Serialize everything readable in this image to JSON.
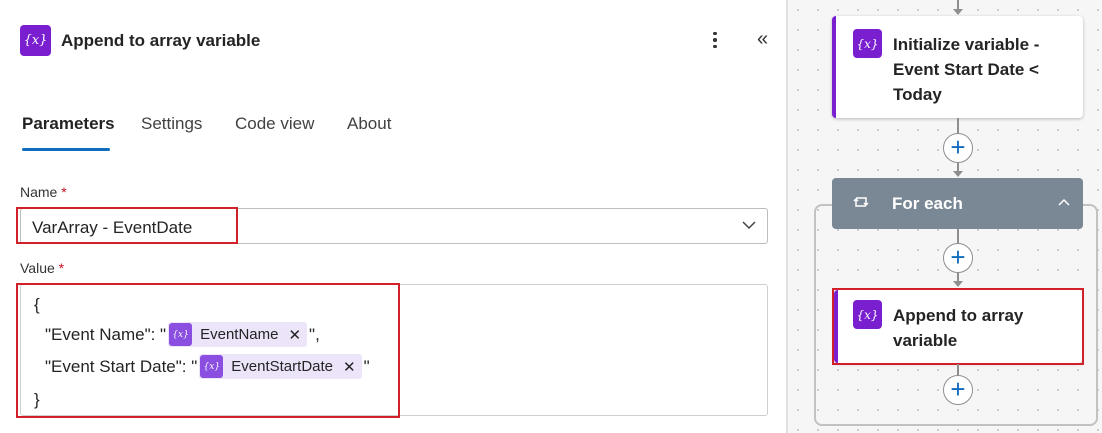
{
  "panel": {
    "title": "Append to array variable",
    "icon": "variable-icon",
    "more_icon": "more-vertical-icon",
    "collapse_icon": "double-chevron-left-icon",
    "collapse_glyph": "«",
    "icon_glyph": "{x}"
  },
  "tabs": [
    {
      "label": "Parameters",
      "active": true
    },
    {
      "label": "Settings",
      "active": false
    },
    {
      "label": "Code view",
      "active": false
    },
    {
      "label": "About",
      "active": false
    }
  ],
  "name_field": {
    "label": "Name",
    "required_mark": "*",
    "value": "VarArray - EventDate"
  },
  "value_field": {
    "label": "Value",
    "required_mark": "*",
    "lines": {
      "open": "{",
      "line1_prefix": "\"Event Name\": \"",
      "line1_token": "EventName",
      "line1_suffix": "\",",
      "line2_prefix": "\"Event Start Date\": \"",
      "line2_token": "EventStartDate",
      "line2_suffix": "\"",
      "close": "}"
    },
    "token_remove_glyph": "✕",
    "token_icon_glyph": "{x}"
  },
  "canvas": {
    "init_card_title": "Initialize variable - Event Start Date < Today",
    "foreach_title": "For each",
    "append_card_title": "Append to array variable",
    "add_glyph": "+",
    "card_icon_glyph": "{x}"
  },
  "colors": {
    "accent_purple": "#7a1fd0",
    "highlight_red": "#d1202a",
    "tab_blue": "#0f6cbd",
    "foreach_gray": "#7a8896"
  }
}
